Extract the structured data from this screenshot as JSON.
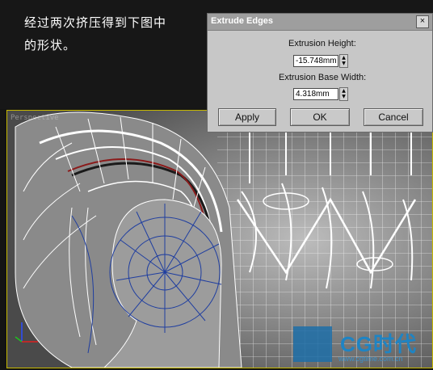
{
  "caption": {
    "line1": "经过两次挤压得到下图中",
    "line2": "的形状。"
  },
  "viewport": {
    "label": "Perspective",
    "selection_color": "#c6b800",
    "selected_edge_color": "#8b1a1a"
  },
  "dialog": {
    "title": "Extrude Edges",
    "close_label": "×",
    "height_label": "Extrusion Height:",
    "height_value": "-15.748mm",
    "width_label": "Extrusion Base Width:",
    "width_value": "4.318mm",
    "spin_up": "▲",
    "spin_down": "▼",
    "apply_label": "Apply",
    "ok_label": "OK",
    "cancel_label": "Cancel"
  },
  "watermark": {
    "brand": "CG时代",
    "url": "www.cgtime.com.cn"
  }
}
